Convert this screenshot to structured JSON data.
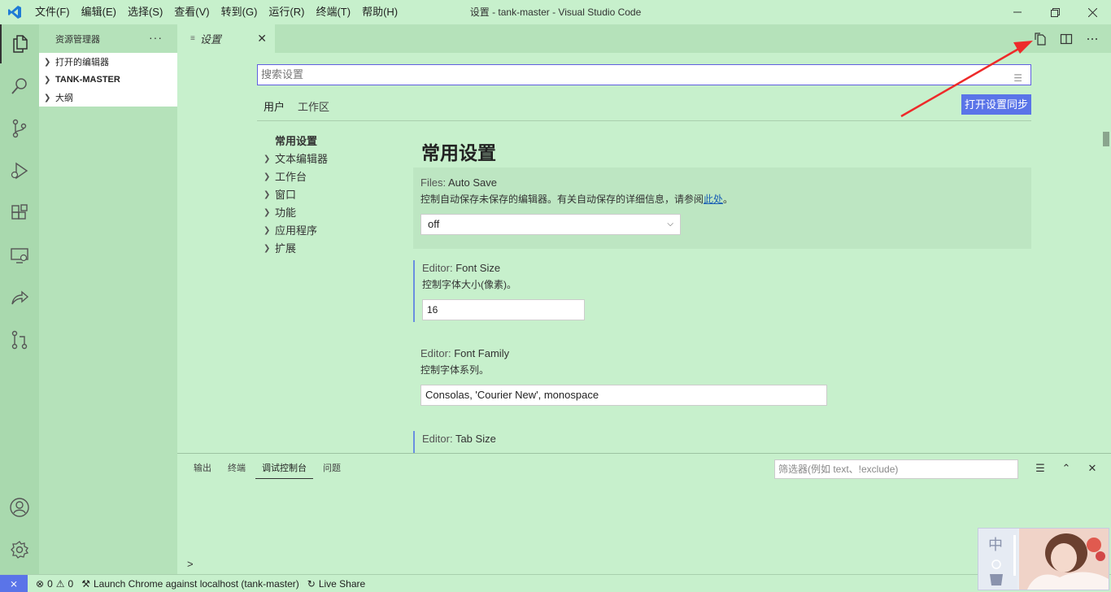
{
  "titlebar": {
    "menus": [
      "文件(F)",
      "编辑(E)",
      "选择(S)",
      "查看(V)",
      "转到(G)",
      "运行(R)",
      "终端(T)",
      "帮助(H)"
    ],
    "title": "设置 - tank-master - Visual Studio Code"
  },
  "activity": [
    "files-icon",
    "search-icon",
    "source-control-icon",
    "run-debug-icon",
    "extensions-icon",
    "remote-explorer-icon",
    "live-share-icon",
    "pull-request-icon",
    "account-icon",
    "gear-icon"
  ],
  "sidebar": {
    "title": "资源管理器",
    "more": "···",
    "sections": [
      "打开的编辑器",
      "TANK-MASTER",
      "大纲"
    ]
  },
  "tab": {
    "label": "设置",
    "icon": "≡"
  },
  "settings": {
    "search_placeholder": "搜索设置",
    "scopes": [
      "用户",
      "工作区"
    ],
    "sync_button": "打开设置同步",
    "toc": [
      "常用设置",
      "文本编辑器",
      "工作台",
      "窗口",
      "功能",
      "应用程序",
      "扩展"
    ],
    "section_title": "常用设置",
    "items": [
      {
        "category": "Files: ",
        "name": "Auto Save",
        "desc": "控制自动保存未保存的编辑器。有关自动保存的详细信息，请参阅",
        "link": "此处",
        "desc_end": "。",
        "value": "off"
      },
      {
        "category": "Editor: ",
        "name": "Font Size",
        "desc": "控制字体大小(像素)。",
        "value": "16"
      },
      {
        "category": "Editor: ",
        "name": "Font Family",
        "desc": "控制字体系列。",
        "value": "Consolas, 'Courier New', monospace"
      },
      {
        "category": "Editor: ",
        "name": "Tab Size"
      }
    ]
  },
  "panel": {
    "tabs": [
      "输出",
      "终端",
      "调试控制台",
      "问题"
    ],
    "filter_placeholder": "筛选器(例如 text、!exclude)",
    "prompt": ">"
  },
  "status": {
    "errors": "0",
    "warnings": "0",
    "launch": "Launch Chrome against localhost (tank-master)",
    "live_share": "Live Share"
  },
  "avatar_char": "中"
}
